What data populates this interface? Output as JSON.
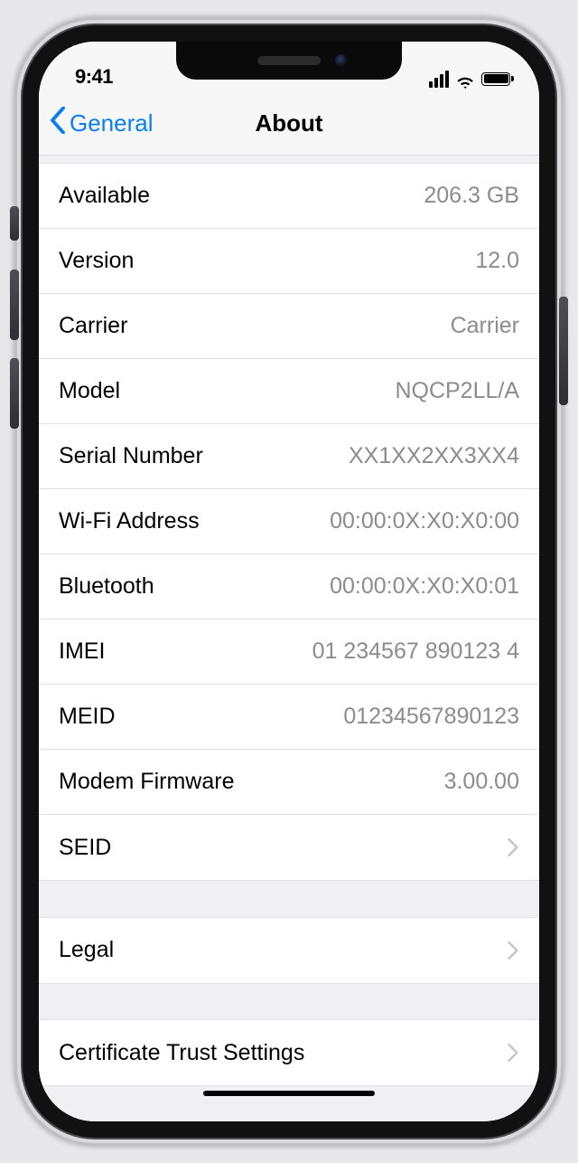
{
  "statusbar": {
    "time": "9:41"
  },
  "nav": {
    "back_label": "General",
    "title": "About"
  },
  "rows": {
    "available": {
      "label": "Available",
      "value": "206.3 GB"
    },
    "version": {
      "label": "Version",
      "value": "12.0"
    },
    "carrier": {
      "label": "Carrier",
      "value": "Carrier"
    },
    "model": {
      "label": "Model",
      "value": "NQCP2LL/A"
    },
    "serial": {
      "label": "Serial Number",
      "value": "XX1XX2XX3XX4"
    },
    "wifi": {
      "label": "Wi-Fi Address",
      "value": "00:00:0X:X0:X0:00"
    },
    "bluetooth": {
      "label": "Bluetooth",
      "value": "00:00:0X:X0:X0:01"
    },
    "imei": {
      "label": "IMEI",
      "value": "01 234567 890123 4"
    },
    "meid": {
      "label": "MEID",
      "value": "01234567890123"
    },
    "modem": {
      "label": "Modem Firmware",
      "value": "3.00.00"
    },
    "seid": {
      "label": "SEID"
    },
    "legal": {
      "label": "Legal"
    },
    "cert": {
      "label": "Certificate Trust Settings"
    }
  }
}
